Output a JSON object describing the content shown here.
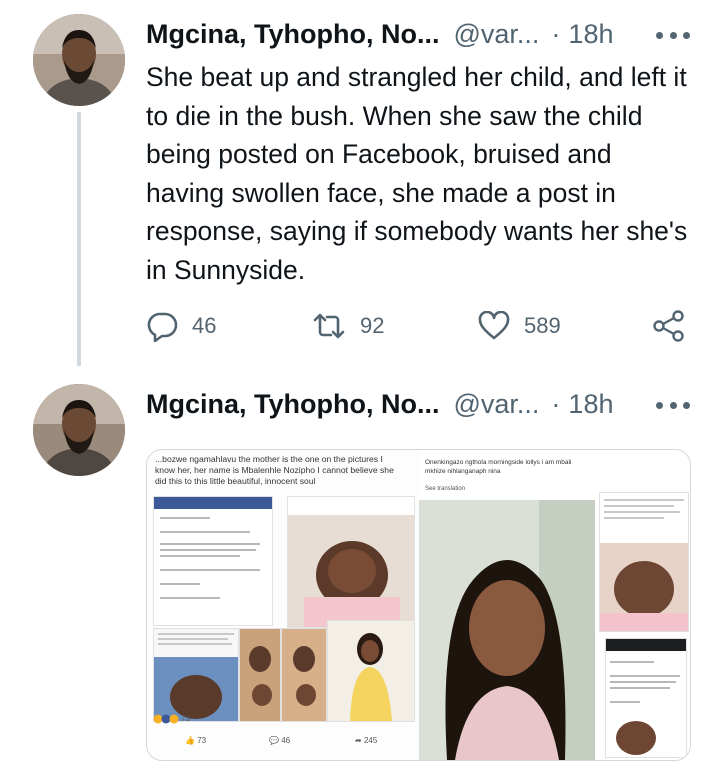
{
  "tweets": [
    {
      "author_name": "Mgcina, Tyhopho, No...",
      "handle": "@var...",
      "separator": "·",
      "time": "18h",
      "text": "She beat up and strangled her child, and left it to die in the bush. When she saw the child being posted on Facebook, bruised and having swollen face, she made a post in response, saying if somebody wants her she's in Sunnyside.",
      "replies": "46",
      "retweets": "92",
      "likes": "589"
    },
    {
      "author_name": "Mgcina, Tyhopho, No...",
      "handle": "@var...",
      "separator": "·",
      "time": "18h",
      "media": {
        "caption": "...bozwe ngamahlavu  the mother is the  one on the pictures I know her, her name is Mbalenhle Nozipho I cannot believe she did this to this little beautiful, innocent soul",
        "reaction_count": "73",
        "post_reactions": "73",
        "post_comments": "46",
        "post_shares": "245",
        "right_caption": "Onenkingazo ngthola morningside lollys i am mbali mkhize nihlanganaph nina",
        "see_translation": "See translation"
      }
    }
  ],
  "colors": {
    "text": "#0f1419",
    "secondary": "#536471",
    "thread_line": "#cfd9de",
    "facebook_blue": "#3b5998"
  },
  "icons": [
    "reply-icon",
    "retweet-icon",
    "like-icon",
    "share-icon",
    "more-icon"
  ]
}
